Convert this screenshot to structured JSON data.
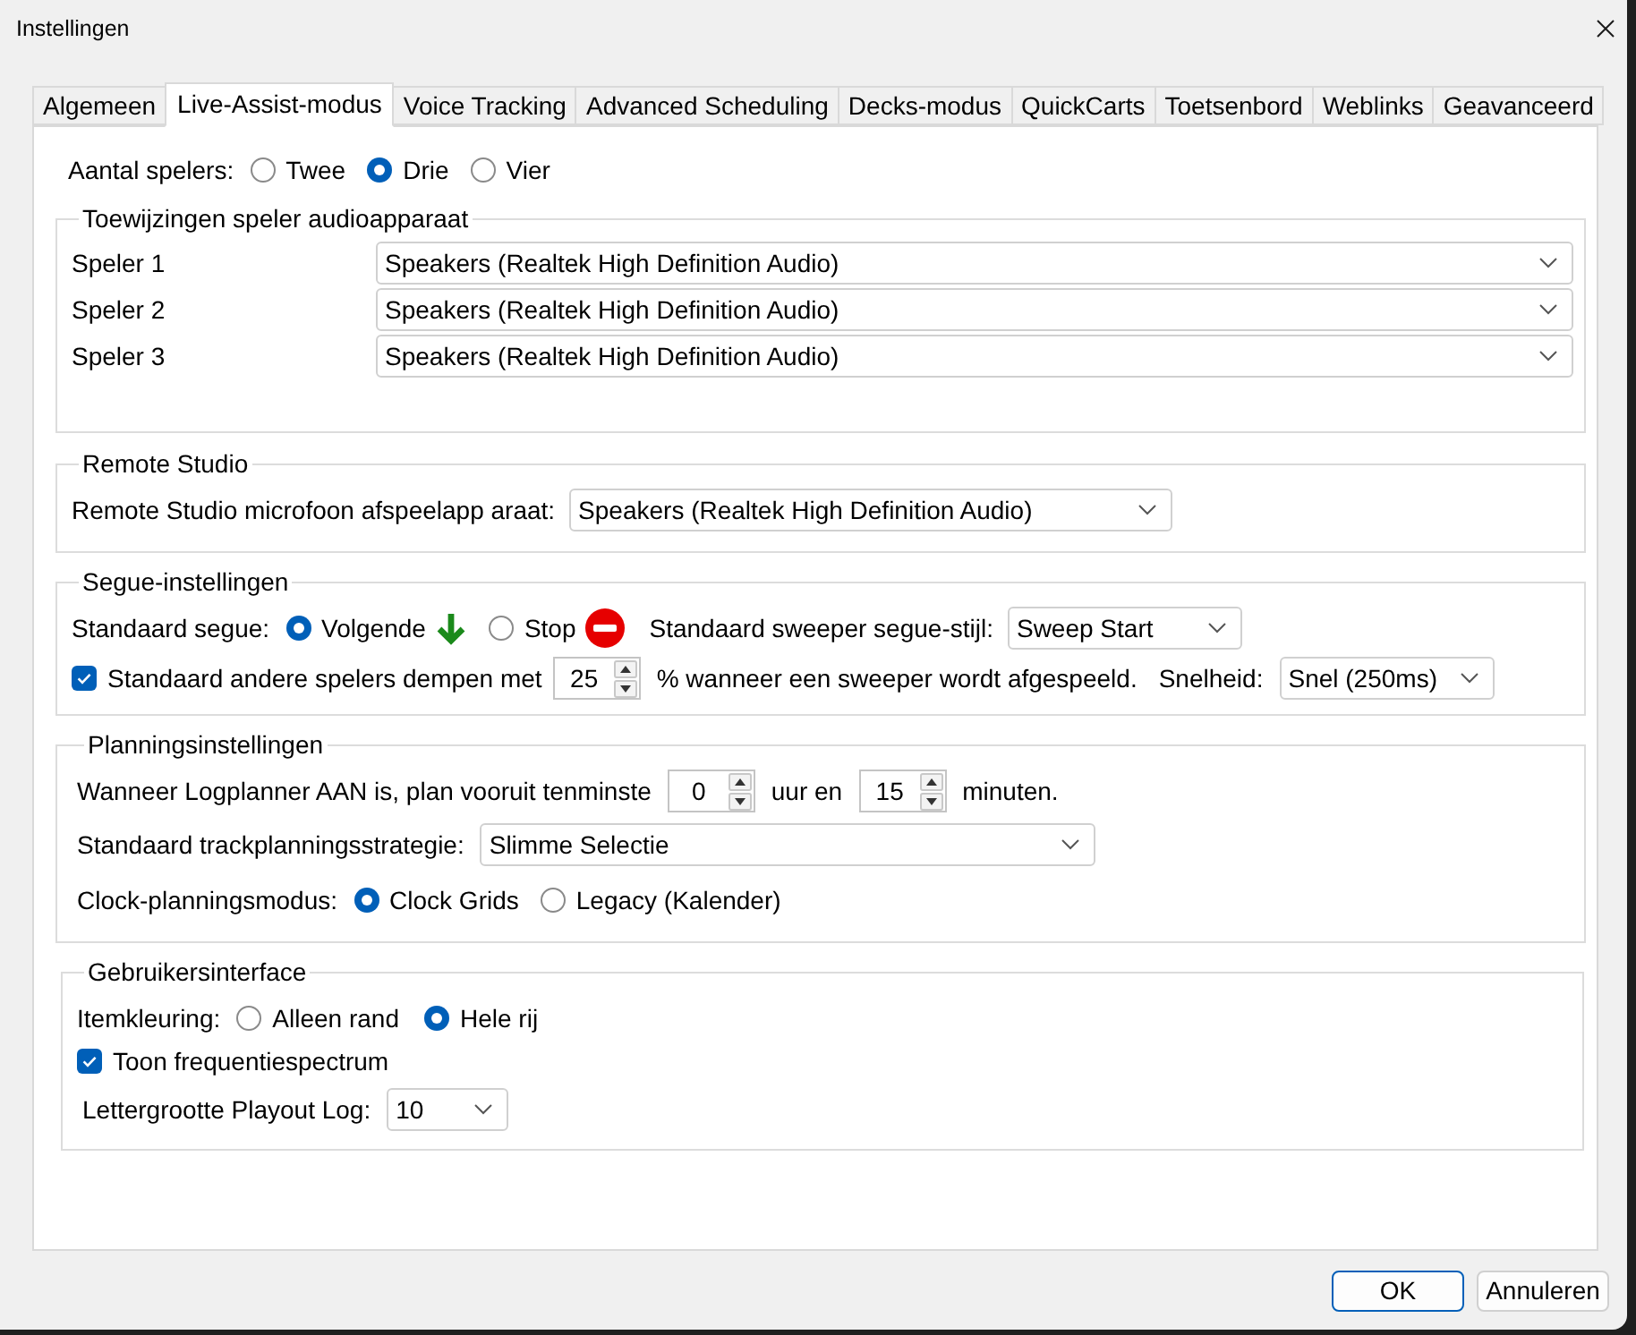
{
  "window": {
    "title": "Instellingen"
  },
  "tabs": [
    {
      "label": "Algemeen",
      "selected": false
    },
    {
      "label": "Live-Assist-modus",
      "selected": true
    },
    {
      "label": "Voice Tracking",
      "selected": false
    },
    {
      "label": "Advanced Scheduling",
      "selected": false
    },
    {
      "label": "Decks-modus",
      "selected": false
    },
    {
      "label": "QuickCarts",
      "selected": false
    },
    {
      "label": "Toetsenbord",
      "selected": false
    },
    {
      "label": "Weblinks",
      "selected": false
    },
    {
      "label": "Geavanceerd",
      "selected": false
    }
  ],
  "player_count": {
    "label": "Aantal spelers:",
    "options": [
      {
        "label": "Twee",
        "selected": false
      },
      {
        "label": "Drie",
        "selected": true
      },
      {
        "label": "Vier",
        "selected": false
      }
    ]
  },
  "device_assignments": {
    "title": "Toewijzingen speler audioapparaat",
    "rows": [
      {
        "label": "Speler 1",
        "value": "Speakers (Realtek High Definition Audio)"
      },
      {
        "label": "Speler 2",
        "value": "Speakers (Realtek High Definition Audio)"
      },
      {
        "label": "Speler 3",
        "value": "Speakers (Realtek High Definition Audio)"
      }
    ]
  },
  "remote_studio": {
    "title": "Remote Studio",
    "label": "Remote Studio microfoon afspeelapp araat:",
    "value": "Speakers (Realtek High Definition Audio)"
  },
  "segue": {
    "title": "Segue-instellingen",
    "default_segue": {
      "label": "Standaard segue:",
      "options": [
        {
          "label": "Volgende",
          "kind": "next",
          "selected": true
        },
        {
          "label": "Stop",
          "kind": "stop",
          "selected": false
        }
      ]
    },
    "sweeper_style": {
      "label": "Standaard sweeper segue-stijl:",
      "value": "Sweep Start"
    },
    "duck": {
      "label": "Standaard andere spelers dempen met",
      "checked": true,
      "value": "25",
      "suffix": "% wanneer een sweeper wordt afgespeeld."
    },
    "speed": {
      "label": "Snelheid:",
      "value": "Snel (250ms)"
    }
  },
  "planning": {
    "title": "Planningsinstellingen",
    "lookahead": {
      "label": "Wanneer Logplanner AAN is, plan vooruit tenminste",
      "hours": "0",
      "hours_unit": "uur en",
      "minutes": "15",
      "minutes_unit": "minuten."
    },
    "strategy": {
      "label": "Standaard trackplanningsstrategie:",
      "value": "Slimme Selectie"
    },
    "clock_mode": {
      "label": "Clock-planningsmodus:",
      "options": [
        {
          "label": "Clock Grids",
          "selected": true
        },
        {
          "label": "Legacy (Kalender)",
          "selected": false
        }
      ]
    }
  },
  "user_interface": {
    "title": "Gebruikersinterface",
    "item_coloring": {
      "label": "Itemkleuring:",
      "options": [
        {
          "label": "Alleen rand",
          "selected": false
        },
        {
          "label": "Hele rij",
          "selected": true
        }
      ]
    },
    "spectrum": {
      "label": "Toon frequentiespectrum",
      "checked": true
    },
    "font_size": {
      "label": "Lettergrootte Playout Log:",
      "value": "10"
    }
  },
  "buttons": [
    {
      "label": "OK",
      "default": true
    },
    {
      "label": "Annuleren",
      "default": false
    }
  ]
}
